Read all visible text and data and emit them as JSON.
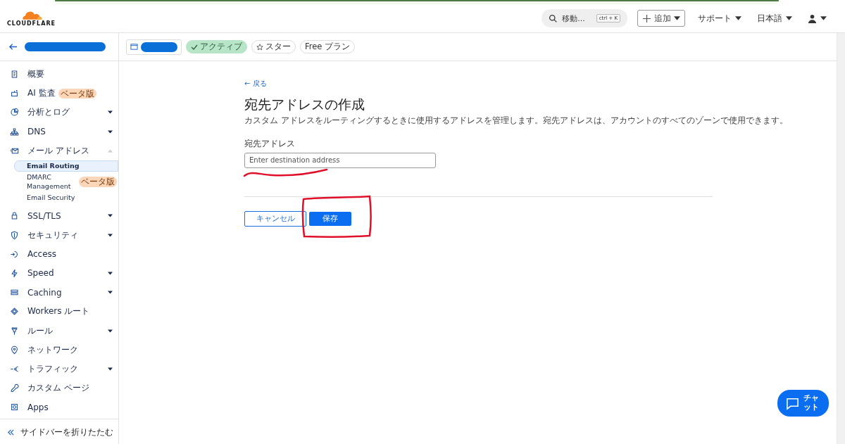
{
  "topbar": {
    "logo": "CLOUDFLARE",
    "search": {
      "label": "移動...",
      "shortcut": "ctrl + K"
    },
    "add_button": "追加",
    "support": "サポート",
    "language": "日本語"
  },
  "zone_bar": {
    "status": "アクティブ",
    "star": "スター",
    "plan": "Free プラン"
  },
  "sidebar": {
    "items": [
      {
        "label": "概要"
      },
      {
        "label": "AI 監査",
        "badge": "ベータ版"
      },
      {
        "label": "分析とログ",
        "expandable": true,
        "expanded": false
      },
      {
        "label": "DNS",
        "expandable": true,
        "expanded": false
      },
      {
        "label": "メール アドレス",
        "expandable": true,
        "expanded": true,
        "children": [
          {
            "label": "Email Routing",
            "selected": true
          },
          {
            "label": "DMARC Management",
            "badge": "ベータ版",
            "selected": false
          },
          {
            "label": "Email Security",
            "selected": false
          }
        ]
      },
      {
        "label": "SSL/TLS",
        "expandable": true,
        "expanded": false
      },
      {
        "label": "セキュリティ",
        "expandable": true,
        "expanded": false
      },
      {
        "label": "Access"
      },
      {
        "label": "Speed",
        "expandable": true,
        "expanded": false
      },
      {
        "label": "Caching",
        "expandable": true,
        "expanded": false
      },
      {
        "label": "Workers ルート"
      },
      {
        "label": "ルール",
        "expandable": true,
        "expanded": false
      },
      {
        "label": "ネットワーク"
      },
      {
        "label": "トラフィック",
        "expandable": true,
        "expanded": false
      },
      {
        "label": "カスタム ページ"
      },
      {
        "label": "Apps"
      }
    ],
    "collapse": "サイドバーを折りたたむ"
  },
  "form": {
    "back": "← 戻る",
    "title": "宛先アドレスの作成",
    "description": "カスタム アドレスをルーティングするときに使用するアドレスを管理します。宛先アドレスは、アカウントのすべてのゾーンで使用できます。",
    "field_label": "宛先アドレス",
    "placeholder": "Enter destination address",
    "cancel": "キャンセル",
    "save": "保存"
  },
  "chat_button": "チャット"
}
